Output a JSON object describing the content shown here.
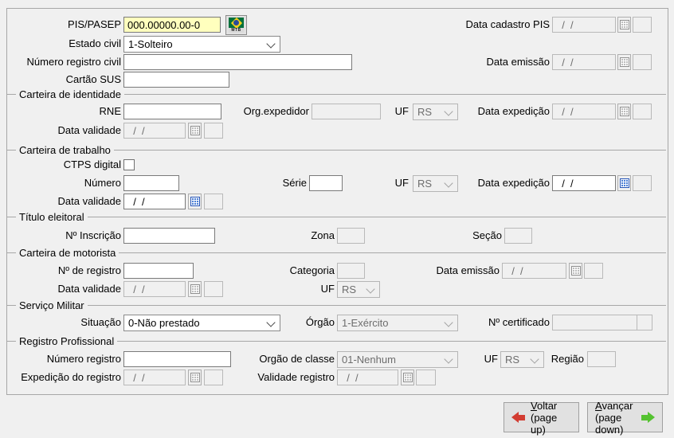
{
  "top": {
    "pis_label": "PIS/PASEP",
    "pis_value": "000.00000.00-0",
    "data_cadastro_pis_label": "Data cadastro PIS",
    "estado_civil_label": "Estado civil",
    "estado_civil_value": "1-Solteiro",
    "numero_registro_civil_label": "Número registro civil",
    "data_emissao_label": "Data emissão",
    "cartao_sus_label": "Cartão SUS"
  },
  "identidade": {
    "title": "Carteira de identidade",
    "rne_label": "RNE",
    "org_expedidor_label": "Org.expedidor",
    "uf_label": "UF",
    "uf_value": "RS",
    "data_expedicao_label": "Data expedição",
    "data_validade_label": "Data validade"
  },
  "trabalho": {
    "title": "Carteira de trabalho",
    "ctps_label": "CTPS digital",
    "numero_label": "Número",
    "serie_label": "Série",
    "uf_label": "UF",
    "uf_value": "RS",
    "data_expedicao_label": "Data expedição",
    "data_validade_label": "Data validade"
  },
  "eleitoral": {
    "title": "Título eleitoral",
    "inscricao_label": "Nº Inscrição",
    "zona_label": "Zona",
    "secao_label": "Seção"
  },
  "motorista": {
    "title": "Carteira de motorista",
    "registro_label": "Nº de registro",
    "categoria_label": "Categoria",
    "data_emissao_label": "Data emissão",
    "data_validade_label": "Data validade",
    "uf_label": "UF",
    "uf_value": "RS"
  },
  "militar": {
    "title": "Serviço Militar",
    "situacao_label": "Situação",
    "situacao_value": "0-Não prestado",
    "orgao_label": "Órgão",
    "orgao_value": "1-Exército",
    "certificado_label": "Nº certificado"
  },
  "profissional": {
    "title": "Registro Profissional",
    "numero_label": "Número registro",
    "orgao_classe_label": "Orgão de classe",
    "orgao_classe_value": "01-Nenhum",
    "uf_label": "UF",
    "uf_value": "RS",
    "regiao_label": "Região",
    "expedicao_label": "Expedição do registro",
    "validade_label": "Validade registro"
  },
  "shared": {
    "date_mask": "  /  /"
  },
  "icons": {
    "mtb_text": "MTB"
  },
  "buttons": {
    "voltar_accel": "V",
    "voltar_rest": "oltar",
    "voltar_sub": "(page up)",
    "avancar_accel": "A",
    "avancar_rest": "vançar",
    "avancar_sub": "(page down)"
  }
}
